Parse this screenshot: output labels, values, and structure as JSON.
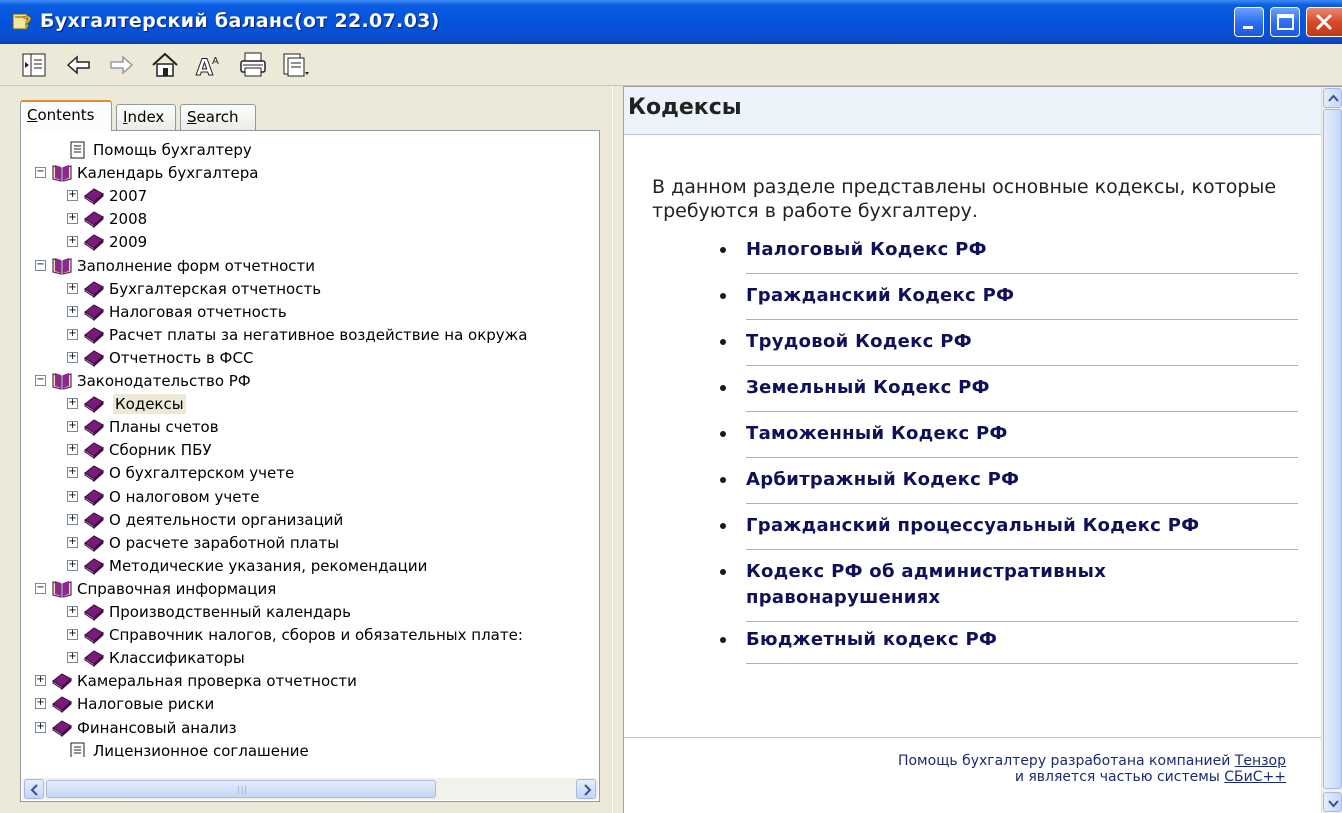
{
  "window": {
    "title": "Бухгалтерский баланс(от 22.07.03)"
  },
  "toolbar": {
    "buttons": [
      "hide-icon",
      "back-icon",
      "forward-icon",
      "home-icon",
      "font-icon",
      "print-icon",
      "options-icon"
    ]
  },
  "tabs": [
    {
      "label": "Contents",
      "accel": "C",
      "rest": "ontents"
    },
    {
      "label": "Index",
      "accel": "I",
      "rest": "ndex"
    },
    {
      "label": "Search",
      "accel": "S",
      "rest": "earch"
    }
  ],
  "tree": [
    {
      "label": "Помощь бухгалтеру",
      "level": 1,
      "kind": "page",
      "expander": ""
    },
    {
      "label": "Календарь бухгалтера",
      "level": 0,
      "kind": "open-book",
      "expander": "−"
    },
    {
      "label": "2007",
      "level": 1,
      "kind": "book",
      "expander": "+"
    },
    {
      "label": "2008",
      "level": 1,
      "kind": "book",
      "expander": "+"
    },
    {
      "label": "2009",
      "level": 1,
      "kind": "book",
      "expander": "+"
    },
    {
      "label": "Заполнение форм отчетности",
      "level": 0,
      "kind": "open-book",
      "expander": "−"
    },
    {
      "label": "Бухгалтерская отчетность",
      "level": 1,
      "kind": "book",
      "expander": "+"
    },
    {
      "label": "Налоговая отчетность",
      "level": 1,
      "kind": "book",
      "expander": "+"
    },
    {
      "label": "Расчет платы за негативное воздействие на окружа",
      "level": 1,
      "kind": "book",
      "expander": "+"
    },
    {
      "label": "Отчетность в ФСС",
      "level": 1,
      "kind": "book",
      "expander": "+"
    },
    {
      "label": "Законодательство РФ",
      "level": 0,
      "kind": "open-book",
      "expander": "−"
    },
    {
      "label": "Кодексы",
      "level": 1,
      "kind": "book",
      "expander": "+",
      "selected": true
    },
    {
      "label": "Планы счетов",
      "level": 1,
      "kind": "book",
      "expander": "+"
    },
    {
      "label": "Сборник ПБУ",
      "level": 1,
      "kind": "book",
      "expander": "+"
    },
    {
      "label": "О бухгалтерском учете",
      "level": 1,
      "kind": "book",
      "expander": "+"
    },
    {
      "label": "О налоговом учете",
      "level": 1,
      "kind": "book",
      "expander": "+"
    },
    {
      "label": "О деятельности организаций",
      "level": 1,
      "kind": "book",
      "expander": "+"
    },
    {
      "label": "О расчете заработной платы",
      "level": 1,
      "kind": "book",
      "expander": "+"
    },
    {
      "label": "Методические указания, рекомендации",
      "level": 1,
      "kind": "book",
      "expander": "+"
    },
    {
      "label": "Справочная информация",
      "level": 0,
      "kind": "open-book",
      "expander": "−"
    },
    {
      "label": "Производственный календарь",
      "level": 1,
      "kind": "book",
      "expander": "+"
    },
    {
      "label": "Справочник налогов, сборов и обязательных плате:",
      "level": 1,
      "kind": "book",
      "expander": "+"
    },
    {
      "label": "Классификаторы",
      "level": 1,
      "kind": "book",
      "expander": "+"
    },
    {
      "label": "Камеральная проверка отчетности",
      "level": 0,
      "kind": "book",
      "expander": "+"
    },
    {
      "label": "Налоговые риски",
      "level": 0,
      "kind": "book",
      "expander": "+"
    },
    {
      "label": "Финансовый анализ",
      "level": 0,
      "kind": "book",
      "expander": "+"
    },
    {
      "label": "Лицензионное соглашение",
      "level": 0,
      "kind": "page",
      "expander": ""
    }
  ],
  "topic": {
    "title": "Кодексы",
    "intro": "В данном разделе представлены основные кодексы, которые требуются в работе бухгалтеру.",
    "links": [
      [
        "Налоговый Кодекс РФ"
      ],
      [
        "Гражданский Кодекс РФ"
      ],
      [
        "Трудовой Кодекс РФ"
      ],
      [
        "Земельный Кодекс РФ"
      ],
      [
        "Таможенный Кодекс РФ"
      ],
      [
        "Арбитражный Кодекс РФ"
      ],
      [
        "Гражданский процессуальный Кодекс РФ"
      ],
      [
        "Кодекс РФ об административных",
        "правонарушениях"
      ],
      [
        "Бюджетный кодекс РФ"
      ]
    ],
    "footer": {
      "line1_prefix": "Помощь бухгалтеру разработана компанией ",
      "line1_link": "Тензор",
      "line2_prefix": "и является частью системы ",
      "line2_link": "СБиС++"
    }
  },
  "colors": {
    "titlebar": "#0453dc",
    "link": "#10105a",
    "book": "#7a1a7a",
    "tab_accent": "#e68b2c"
  }
}
